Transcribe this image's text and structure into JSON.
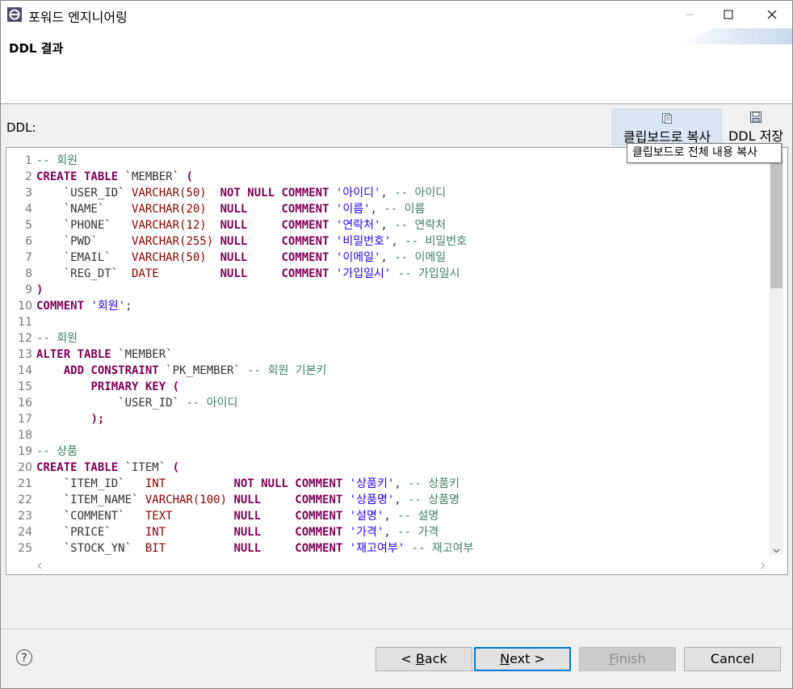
{
  "window": {
    "title": "포워드 엔지니어링"
  },
  "header": {
    "page_title": "DDL 결과"
  },
  "ddl_label": "DDL:",
  "toolbar": {
    "copy_label": "클립보드로 복사",
    "save_label": "DDL 저장",
    "tooltip": "클립보드로 전체 내용 복사"
  },
  "line_numbers": [
    "1",
    "2",
    "3",
    "4",
    "5",
    "6",
    "7",
    "8",
    "9",
    "10",
    "11",
    "12",
    "13",
    "14",
    "15",
    "16",
    "17",
    "18",
    "19",
    "20",
    "21",
    "22",
    "23",
    "24",
    "25"
  ],
  "code_lines": [
    [
      {
        "t": "com",
        "v": "-- 회원"
      }
    ],
    [
      {
        "t": "kw",
        "v": "CREATE TABLE "
      },
      {
        "t": "id",
        "v": "`MEMBER` "
      },
      {
        "t": "kw",
        "v": "("
      }
    ],
    [
      {
        "t": "id",
        "v": "    `USER_ID` "
      },
      {
        "t": "type",
        "v": "VARCHAR(50)"
      },
      {
        "t": "id",
        "v": "  "
      },
      {
        "t": "kw",
        "v": "NOT NULL COMMENT "
      },
      {
        "t": "str",
        "v": "'아이디'"
      },
      {
        "t": "id",
        "v": ", "
      },
      {
        "t": "com",
        "v": "-- 아이디"
      }
    ],
    [
      {
        "t": "id",
        "v": "    `NAME`    "
      },
      {
        "t": "type",
        "v": "VARCHAR(20)"
      },
      {
        "t": "id",
        "v": "  "
      },
      {
        "t": "kw",
        "v": "NULL     COMMENT "
      },
      {
        "t": "str",
        "v": "'이름'"
      },
      {
        "t": "id",
        "v": ", "
      },
      {
        "t": "com",
        "v": "-- 이름"
      }
    ],
    [
      {
        "t": "id",
        "v": "    `PHONE`   "
      },
      {
        "t": "type",
        "v": "VARCHAR(12)"
      },
      {
        "t": "id",
        "v": "  "
      },
      {
        "t": "kw",
        "v": "NULL     COMMENT "
      },
      {
        "t": "str",
        "v": "'연락처'"
      },
      {
        "t": "id",
        "v": ", "
      },
      {
        "t": "com",
        "v": "-- 연락처"
      }
    ],
    [
      {
        "t": "id",
        "v": "    `PWD`     "
      },
      {
        "t": "type",
        "v": "VARCHAR(255)"
      },
      {
        "t": "id",
        "v": " "
      },
      {
        "t": "kw",
        "v": "NULL     COMMENT "
      },
      {
        "t": "str",
        "v": "'비밀번호'"
      },
      {
        "t": "id",
        "v": ", "
      },
      {
        "t": "com",
        "v": "-- 비밀번호"
      }
    ],
    [
      {
        "t": "id",
        "v": "    `EMAIL`   "
      },
      {
        "t": "type",
        "v": "VARCHAR(50)"
      },
      {
        "t": "id",
        "v": "  "
      },
      {
        "t": "kw",
        "v": "NULL     COMMENT "
      },
      {
        "t": "str",
        "v": "'이메일'"
      },
      {
        "t": "id",
        "v": ", "
      },
      {
        "t": "com",
        "v": "-- 이메일"
      }
    ],
    [
      {
        "t": "id",
        "v": "    `REG_DT`  "
      },
      {
        "t": "type",
        "v": "DATE"
      },
      {
        "t": "id",
        "v": "         "
      },
      {
        "t": "kw",
        "v": "NULL     COMMENT "
      },
      {
        "t": "str",
        "v": "'가입일시'"
      },
      {
        "t": "id",
        "v": " "
      },
      {
        "t": "com",
        "v": "-- 가입일시"
      }
    ],
    [
      {
        "t": "kw",
        "v": ")"
      }
    ],
    [
      {
        "t": "kw",
        "v": "COMMENT "
      },
      {
        "t": "str",
        "v": "'회원'"
      },
      {
        "t": "id",
        "v": ";"
      }
    ],
    [
      {
        "t": "id",
        "v": ""
      }
    ],
    [
      {
        "t": "com",
        "v": "-- 회원"
      }
    ],
    [
      {
        "t": "kw",
        "v": "ALTER TABLE "
      },
      {
        "t": "id",
        "v": "`MEMBER`"
      }
    ],
    [
      {
        "t": "id",
        "v": "    "
      },
      {
        "t": "kw",
        "v": "ADD CONSTRAINT "
      },
      {
        "t": "id",
        "v": "`PK_MEMBER` "
      },
      {
        "t": "com",
        "v": "-- 회원 기본키"
      }
    ],
    [
      {
        "t": "id",
        "v": "        "
      },
      {
        "t": "kw",
        "v": "PRIMARY KEY ("
      }
    ],
    [
      {
        "t": "id",
        "v": "            `USER_ID` "
      },
      {
        "t": "com",
        "v": "-- 아이디"
      }
    ],
    [
      {
        "t": "id",
        "v": "        "
      },
      {
        "t": "kw",
        "v": ");"
      }
    ],
    [
      {
        "t": "id",
        "v": ""
      }
    ],
    [
      {
        "t": "com",
        "v": "-- 상품"
      }
    ],
    [
      {
        "t": "kw",
        "v": "CREATE TABLE "
      },
      {
        "t": "id",
        "v": "`ITEM` "
      },
      {
        "t": "kw",
        "v": "("
      }
    ],
    [
      {
        "t": "id",
        "v": "    `ITEM_ID`   "
      },
      {
        "t": "type",
        "v": "INT"
      },
      {
        "t": "id",
        "v": "          "
      },
      {
        "t": "kw",
        "v": "NOT NULL COMMENT "
      },
      {
        "t": "str",
        "v": "'상품키'"
      },
      {
        "t": "id",
        "v": ", "
      },
      {
        "t": "com",
        "v": "-- 상품키"
      }
    ],
    [
      {
        "t": "id",
        "v": "    `ITEM_NAME` "
      },
      {
        "t": "type",
        "v": "VARCHAR(100)"
      },
      {
        "t": "id",
        "v": " "
      },
      {
        "t": "kw",
        "v": "NULL     COMMENT "
      },
      {
        "t": "str",
        "v": "'상품명'"
      },
      {
        "t": "id",
        "v": ", "
      },
      {
        "t": "com",
        "v": "-- 상품명"
      }
    ],
    [
      {
        "t": "id",
        "v": "    `COMMENT`   "
      },
      {
        "t": "type",
        "v": "TEXT"
      },
      {
        "t": "id",
        "v": "         "
      },
      {
        "t": "kw",
        "v": "NULL     COMMENT "
      },
      {
        "t": "str",
        "v": "'설명'"
      },
      {
        "t": "id",
        "v": ", "
      },
      {
        "t": "com",
        "v": "-- 설명"
      }
    ],
    [
      {
        "t": "id",
        "v": "    `PRICE`     "
      },
      {
        "t": "type",
        "v": "INT"
      },
      {
        "t": "id",
        "v": "          "
      },
      {
        "t": "kw",
        "v": "NULL     COMMENT "
      },
      {
        "t": "str",
        "v": "'가격'"
      },
      {
        "t": "id",
        "v": ", "
      },
      {
        "t": "com",
        "v": "-- 가격"
      }
    ],
    [
      {
        "t": "id",
        "v": "    `STOCK_YN`  "
      },
      {
        "t": "type",
        "v": "BIT"
      },
      {
        "t": "id",
        "v": "          "
      },
      {
        "t": "kw",
        "v": "NULL     COMMENT "
      },
      {
        "t": "str",
        "v": "'재고여부'"
      },
      {
        "t": "id",
        "v": " "
      },
      {
        "t": "com",
        "v": "-- 재고여부"
      }
    ]
  ],
  "buttons": {
    "back": {
      "prefix": "< ",
      "mnemonic": "B",
      "rest": "ack"
    },
    "next": {
      "mnemonic": "N",
      "rest": "ext >"
    },
    "finish": {
      "mnemonic": "F",
      "rest": "inish"
    },
    "cancel": "Cancel"
  },
  "help_glyph": "?",
  "colors": {
    "keyword": "#7f0055",
    "string": "#2a00ff",
    "comment": "#3f7f5f",
    "type": "#8b0000",
    "focus": "#0078d7"
  }
}
